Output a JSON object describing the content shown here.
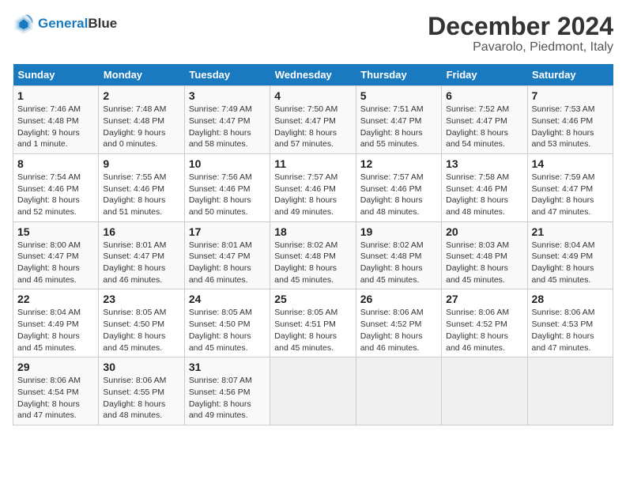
{
  "header": {
    "logo_line1": "General",
    "logo_line2": "Blue",
    "title": "December 2024",
    "subtitle": "Pavarolo, Piedmont, Italy"
  },
  "days_of_week": [
    "Sunday",
    "Monday",
    "Tuesday",
    "Wednesday",
    "Thursday",
    "Friday",
    "Saturday"
  ],
  "weeks": [
    [
      {
        "day": "1",
        "info": "Sunrise: 7:46 AM\nSunset: 4:48 PM\nDaylight: 9 hours\nand 1 minute."
      },
      {
        "day": "2",
        "info": "Sunrise: 7:48 AM\nSunset: 4:48 PM\nDaylight: 9 hours\nand 0 minutes."
      },
      {
        "day": "3",
        "info": "Sunrise: 7:49 AM\nSunset: 4:47 PM\nDaylight: 8 hours\nand 58 minutes."
      },
      {
        "day": "4",
        "info": "Sunrise: 7:50 AM\nSunset: 4:47 PM\nDaylight: 8 hours\nand 57 minutes."
      },
      {
        "day": "5",
        "info": "Sunrise: 7:51 AM\nSunset: 4:47 PM\nDaylight: 8 hours\nand 55 minutes."
      },
      {
        "day": "6",
        "info": "Sunrise: 7:52 AM\nSunset: 4:47 PM\nDaylight: 8 hours\nand 54 minutes."
      },
      {
        "day": "7",
        "info": "Sunrise: 7:53 AM\nSunset: 4:46 PM\nDaylight: 8 hours\nand 53 minutes."
      }
    ],
    [
      {
        "day": "8",
        "info": "Sunrise: 7:54 AM\nSunset: 4:46 PM\nDaylight: 8 hours\nand 52 minutes."
      },
      {
        "day": "9",
        "info": "Sunrise: 7:55 AM\nSunset: 4:46 PM\nDaylight: 8 hours\nand 51 minutes."
      },
      {
        "day": "10",
        "info": "Sunrise: 7:56 AM\nSunset: 4:46 PM\nDaylight: 8 hours\nand 50 minutes."
      },
      {
        "day": "11",
        "info": "Sunrise: 7:57 AM\nSunset: 4:46 PM\nDaylight: 8 hours\nand 49 minutes."
      },
      {
        "day": "12",
        "info": "Sunrise: 7:57 AM\nSunset: 4:46 PM\nDaylight: 8 hours\nand 48 minutes."
      },
      {
        "day": "13",
        "info": "Sunrise: 7:58 AM\nSunset: 4:46 PM\nDaylight: 8 hours\nand 48 minutes."
      },
      {
        "day": "14",
        "info": "Sunrise: 7:59 AM\nSunset: 4:47 PM\nDaylight: 8 hours\nand 47 minutes."
      }
    ],
    [
      {
        "day": "15",
        "info": "Sunrise: 8:00 AM\nSunset: 4:47 PM\nDaylight: 8 hours\nand 46 minutes."
      },
      {
        "day": "16",
        "info": "Sunrise: 8:01 AM\nSunset: 4:47 PM\nDaylight: 8 hours\nand 46 minutes."
      },
      {
        "day": "17",
        "info": "Sunrise: 8:01 AM\nSunset: 4:47 PM\nDaylight: 8 hours\nand 46 minutes."
      },
      {
        "day": "18",
        "info": "Sunrise: 8:02 AM\nSunset: 4:48 PM\nDaylight: 8 hours\nand 45 minutes."
      },
      {
        "day": "19",
        "info": "Sunrise: 8:02 AM\nSunset: 4:48 PM\nDaylight: 8 hours\nand 45 minutes."
      },
      {
        "day": "20",
        "info": "Sunrise: 8:03 AM\nSunset: 4:48 PM\nDaylight: 8 hours\nand 45 minutes."
      },
      {
        "day": "21",
        "info": "Sunrise: 8:04 AM\nSunset: 4:49 PM\nDaylight: 8 hours\nand 45 minutes."
      }
    ],
    [
      {
        "day": "22",
        "info": "Sunrise: 8:04 AM\nSunset: 4:49 PM\nDaylight: 8 hours\nand 45 minutes."
      },
      {
        "day": "23",
        "info": "Sunrise: 8:05 AM\nSunset: 4:50 PM\nDaylight: 8 hours\nand 45 minutes."
      },
      {
        "day": "24",
        "info": "Sunrise: 8:05 AM\nSunset: 4:50 PM\nDaylight: 8 hours\nand 45 minutes."
      },
      {
        "day": "25",
        "info": "Sunrise: 8:05 AM\nSunset: 4:51 PM\nDaylight: 8 hours\nand 45 minutes."
      },
      {
        "day": "26",
        "info": "Sunrise: 8:06 AM\nSunset: 4:52 PM\nDaylight: 8 hours\nand 46 minutes."
      },
      {
        "day": "27",
        "info": "Sunrise: 8:06 AM\nSunset: 4:52 PM\nDaylight: 8 hours\nand 46 minutes."
      },
      {
        "day": "28",
        "info": "Sunrise: 8:06 AM\nSunset: 4:53 PM\nDaylight: 8 hours\nand 47 minutes."
      }
    ],
    [
      {
        "day": "29",
        "info": "Sunrise: 8:06 AM\nSunset: 4:54 PM\nDaylight: 8 hours\nand 47 minutes."
      },
      {
        "day": "30",
        "info": "Sunrise: 8:06 AM\nSunset: 4:55 PM\nDaylight: 8 hours\nand 48 minutes."
      },
      {
        "day": "31",
        "info": "Sunrise: 8:07 AM\nSunset: 4:56 PM\nDaylight: 8 hours\nand 49 minutes."
      },
      {
        "day": "",
        "info": ""
      },
      {
        "day": "",
        "info": ""
      },
      {
        "day": "",
        "info": ""
      },
      {
        "day": "",
        "info": ""
      }
    ]
  ]
}
